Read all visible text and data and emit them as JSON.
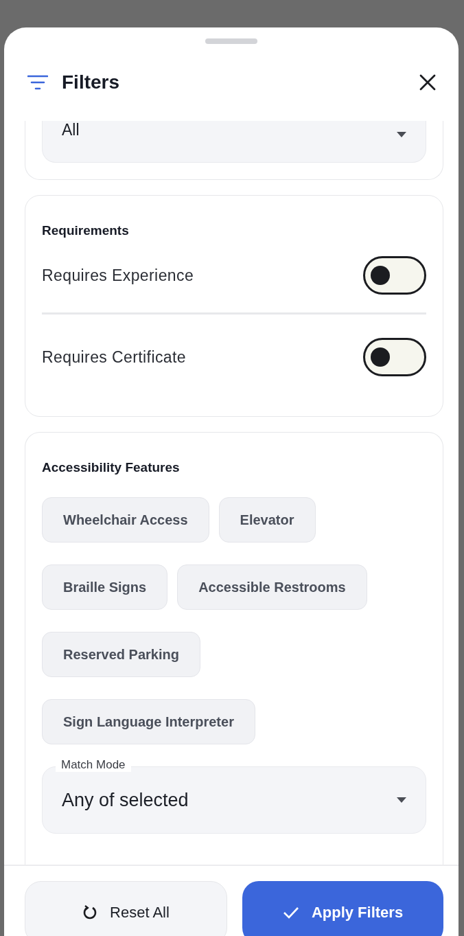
{
  "sheet": {
    "title": "Filters"
  },
  "top_select": {
    "value": "All"
  },
  "requirements": {
    "title": "Requirements",
    "toggles": [
      {
        "label": "Requires Experience",
        "on": false
      },
      {
        "label": "Requires Certificate",
        "on": false
      }
    ]
  },
  "accessibility": {
    "title": "Accessibility Features",
    "chips": [
      {
        "label": "Wheelchair Access",
        "selected": false
      },
      {
        "label": "Elevator",
        "selected": false
      },
      {
        "label": "Braille Signs",
        "selected": false
      },
      {
        "label": "Accessible Restrooms",
        "selected": false
      },
      {
        "label": "Reserved Parking",
        "selected": false
      },
      {
        "label": "Sign Language Interpreter",
        "selected": false
      }
    ],
    "match_mode": {
      "label": "Match Mode",
      "value": "Any of selected"
    }
  },
  "footer": {
    "reset": "Reset All",
    "apply": "Apply Filters"
  }
}
